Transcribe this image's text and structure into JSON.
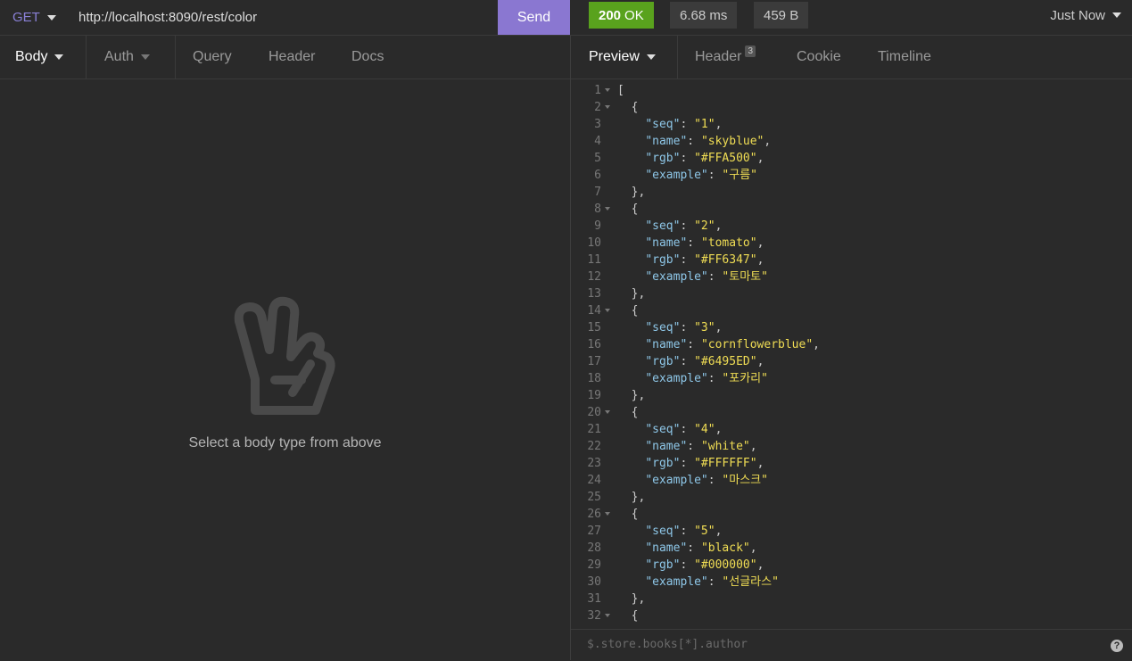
{
  "request": {
    "method": "GET",
    "url": "http://localhost:8090/rest/color",
    "send_label": "Send"
  },
  "response_meta": {
    "status_code": "200",
    "status_text": "OK",
    "time": "6.68 ms",
    "size": "459 B",
    "history": "Just Now"
  },
  "request_tabs": {
    "body": "Body",
    "auth": "Auth",
    "query": "Query",
    "header": "Header",
    "docs": "Docs"
  },
  "empty_state": {
    "icon": "peace-hand-icon",
    "message": "Select a body type from above"
  },
  "response_tabs": {
    "preview": "Preview",
    "header": "Header",
    "header_count": "3",
    "cookie": "Cookie",
    "timeline": "Timeline"
  },
  "response_body": [
    {
      "seq": "1",
      "name": "skyblue",
      "rgb": "#FFA500",
      "example": "구름"
    },
    {
      "seq": "2",
      "name": "tomato",
      "rgb": "#FF6347",
      "example": "토마토"
    },
    {
      "seq": "3",
      "name": "cornflowerblue",
      "rgb": "#6495ED",
      "example": "포카리"
    },
    {
      "seq": "4",
      "name": "white",
      "rgb": "#FFFFFF",
      "example": "마스크"
    },
    {
      "seq": "5",
      "name": "black",
      "rgb": "#000000",
      "example": "선글라스"
    }
  ],
  "filter": {
    "placeholder": "$.store.books[*].author"
  },
  "colors": {
    "background": "#2a2a2a",
    "accent": "#8a77d1",
    "success": "#59a21d",
    "json_key": "#8ec7e8",
    "json_value": "#f0dd54"
  }
}
